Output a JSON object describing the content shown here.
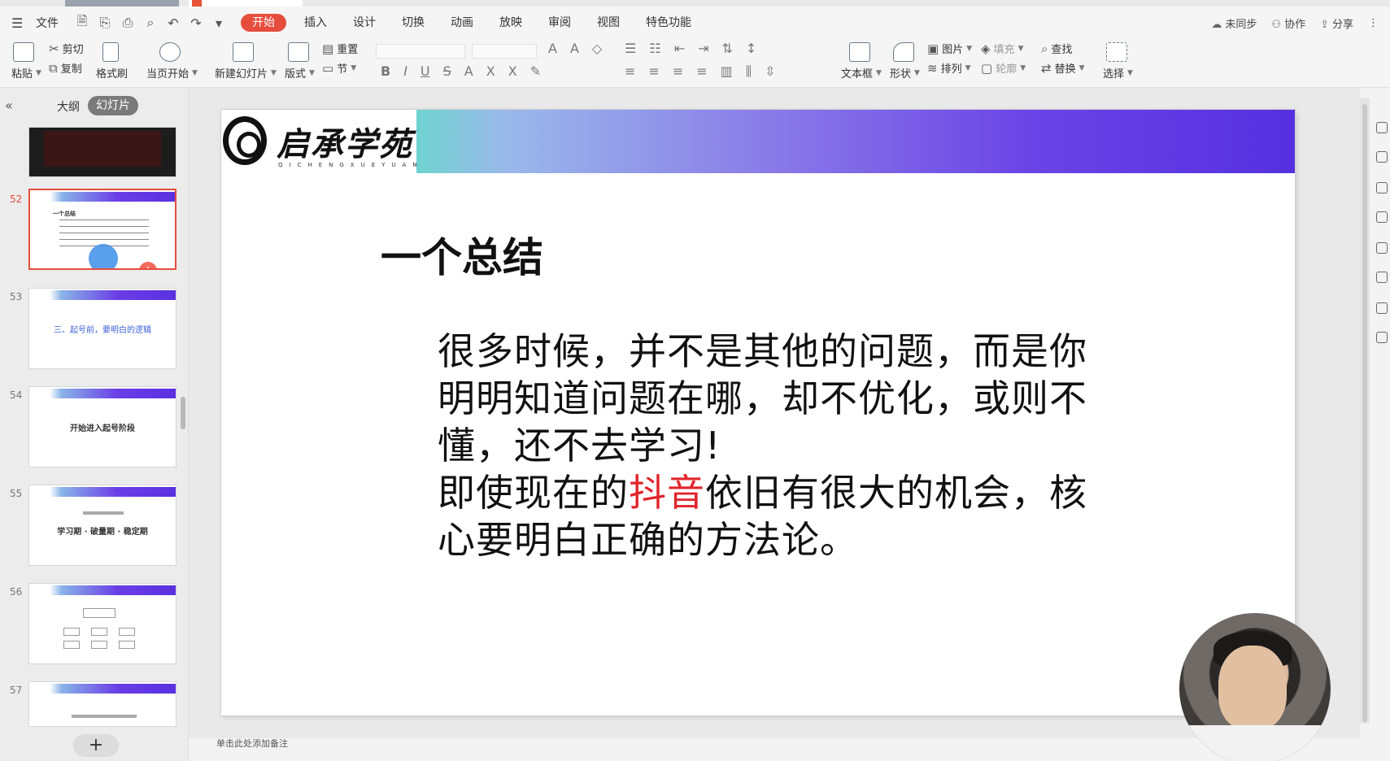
{
  "menu": {
    "file": "文件",
    "tabs": [
      "开始",
      "插入",
      "设计",
      "切换",
      "动画",
      "放映",
      "审阅",
      "视图",
      "特色功能"
    ],
    "right": {
      "sync": "未同步",
      "collab": "协作",
      "share": "分享"
    }
  },
  "ribbon": {
    "paste": "粘贴",
    "cut": "剪切",
    "copy": "复制",
    "format_painter": "格式刷",
    "from_current": "当页开始",
    "new_slide": "新建幻灯片",
    "layout": "版式",
    "reset": "重置",
    "section": "节",
    "textbox": "文本框",
    "shape": "形状",
    "arrange": "排列",
    "picture": "图片",
    "fill": "填充",
    "outline": "轮廓",
    "find": "查找",
    "replace": "替换",
    "select": "选择"
  },
  "leftpanel": {
    "outline": "大纲",
    "slides": "幻灯片",
    "thumbs": [
      {
        "num": "52",
        "text": "一个总结"
      },
      {
        "num": "53",
        "text": "三、起号前，要明白的逻辑"
      },
      {
        "num": "54",
        "text": "开始进入起号阶段"
      },
      {
        "num": "55",
        "text": "学习期 · 破量期 · 稳定期"
      },
      {
        "num": "56",
        "text": ""
      },
      {
        "num": "57",
        "text": ""
      }
    ],
    "add": "+"
  },
  "slide": {
    "logo_text": "启承学苑",
    "logo_sub": "QICHENGXUEYUAN",
    "title": "一个总结",
    "body_part1": "很多时候，并不是其他的问题，而是你明明知道问题在哪，却不优化，或则不懂，还不去学习!",
    "body_part2": "即使现在的",
    "body_highlight": "抖音",
    "body_part3": "依旧有很大的机会，核心要明白正确的方法论。"
  },
  "notes_placeholder": "单击此处添加备注",
  "colors": {
    "accent": "#e64d3d",
    "highlight": "#e0242b",
    "band_end": "#5530e0"
  }
}
